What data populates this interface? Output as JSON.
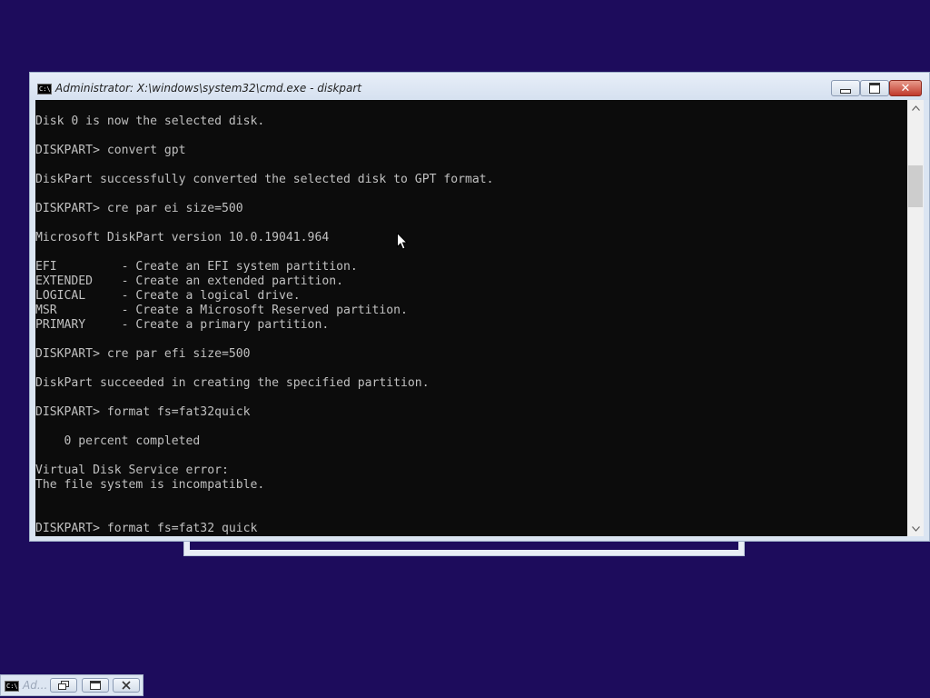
{
  "window": {
    "title": "Administrator: X:\\windows\\system32\\cmd.exe - diskpart",
    "icon": "cmd-icon",
    "icon_text": "C:\\.",
    "close_glyph": "✕"
  },
  "console": {
    "lines": [
      "Disk 0 is now the selected disk.",
      "",
      "DISKPART> convert gpt",
      "",
      "DiskPart successfully converted the selected disk to GPT format.",
      "",
      "DISKPART> cre par ei size=500",
      "",
      "Microsoft DiskPart version 10.0.19041.964",
      "",
      "EFI         - Create an EFI system partition.",
      "EXTENDED    - Create an extended partition.",
      "LOGICAL     - Create a logical drive.",
      "MSR         - Create a Microsoft Reserved partition.",
      "PRIMARY     - Create a primary partition.",
      "",
      "DISKPART> cre par efi size=500",
      "",
      "DiskPart succeeded in creating the specified partition.",
      "",
      "DISKPART> format fs=fat32quick",
      "",
      "    0 percent completed",
      "",
      "Virtual Disk Service error:",
      "The file system is incompatible.",
      "",
      "",
      "DISKPART> format fs=fat32 quick"
    ]
  },
  "taskbar": {
    "label": "Ad...",
    "icon": "cmd-icon",
    "icon_text": "C:\\."
  },
  "colors": {
    "desktop": "#1d0c5c",
    "console_bg": "#0c0c0c",
    "console_text": "#c0c0c0",
    "close_button": "#c0392b"
  }
}
